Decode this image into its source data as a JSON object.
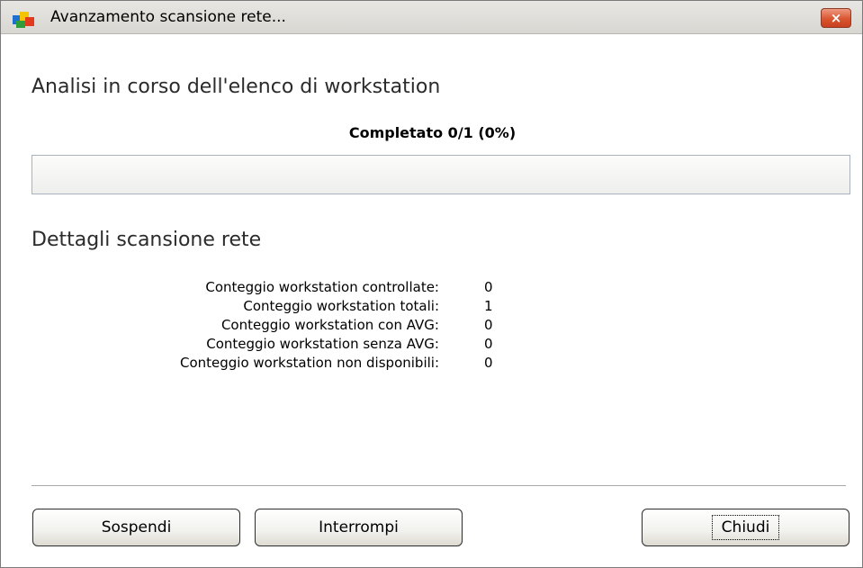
{
  "window": {
    "title": "Avanzamento scansione rete...",
    "close_label": "×",
    "accent_color": "#0a246a"
  },
  "main": {
    "heading": "Analisi in corso dell'elenco di workstation",
    "progress_label": "Completato 0/1 (0%)",
    "progress_fraction": 0.0
  },
  "details": {
    "heading": "Dettagli scansione rete",
    "rows": [
      {
        "label": "Conteggio workstation controllate:",
        "value": "0"
      },
      {
        "label": "Conteggio workstation totali:",
        "value": "1"
      },
      {
        "label": "Conteggio workstation con AVG:",
        "value": "0"
      },
      {
        "label": "Conteggio workstation senza AVG:",
        "value": "0"
      },
      {
        "label": "Conteggio workstation non disponibili:",
        "value": "0"
      }
    ]
  },
  "buttons": {
    "suspend_label": "Sospendi",
    "stop_label": "Interrompi",
    "close_label": "Chiudi"
  }
}
